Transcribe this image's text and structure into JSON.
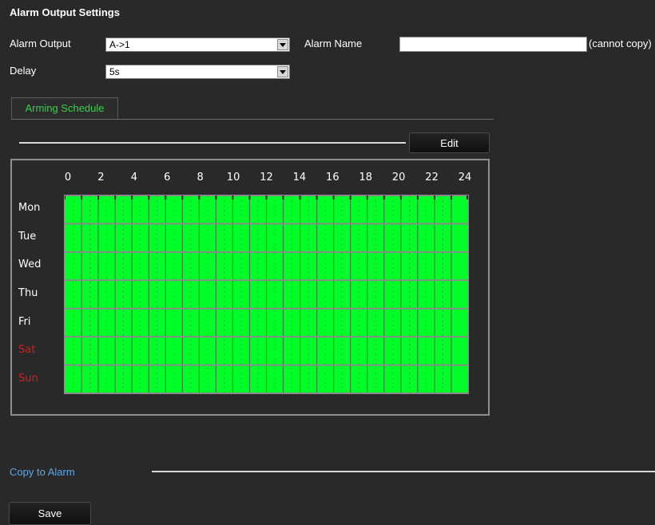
{
  "page": {
    "title": "Alarm Output Settings"
  },
  "form": {
    "alarm_output_label": "Alarm Output",
    "alarm_output_value": "A->1",
    "alarm_name_label": "Alarm Name",
    "alarm_name_value": "",
    "alarm_name_note": "(cannot copy)",
    "delay_label": "Delay",
    "delay_value": "5s"
  },
  "tabs": [
    {
      "label": "Arming Schedule",
      "active": true
    }
  ],
  "schedule": {
    "edit_label": "Edit",
    "hour_labels": [
      "0",
      "2",
      "4",
      "6",
      "8",
      "10",
      "12",
      "14",
      "16",
      "18",
      "20",
      "22",
      "24"
    ],
    "days": [
      {
        "label": "Mon",
        "weekend": false,
        "armed_fraction": 1.0
      },
      {
        "label": "Tue",
        "weekend": false,
        "armed_fraction": 1.0
      },
      {
        "label": "Wed",
        "weekend": false,
        "armed_fraction": 1.0
      },
      {
        "label": "Thu",
        "weekend": false,
        "armed_fraction": 1.0
      },
      {
        "label": "Fri",
        "weekend": false,
        "armed_fraction": 1.0
      },
      {
        "label": "Sat",
        "weekend": true,
        "armed_fraction": 1.0
      },
      {
        "label": "Sun",
        "weekend": true,
        "armed_fraction": 1.0
      }
    ]
  },
  "footer": {
    "copy_to_alarm_label": "Copy to Alarm",
    "save_label": "Save"
  },
  "colors": {
    "background": "#292929",
    "armed": "#00ff28",
    "tab_text": "#32d14a",
    "weekend_text": "#d02020",
    "link": "#5aa8e8"
  },
  "icons": {
    "dropdown": "chevron-down-icon"
  }
}
